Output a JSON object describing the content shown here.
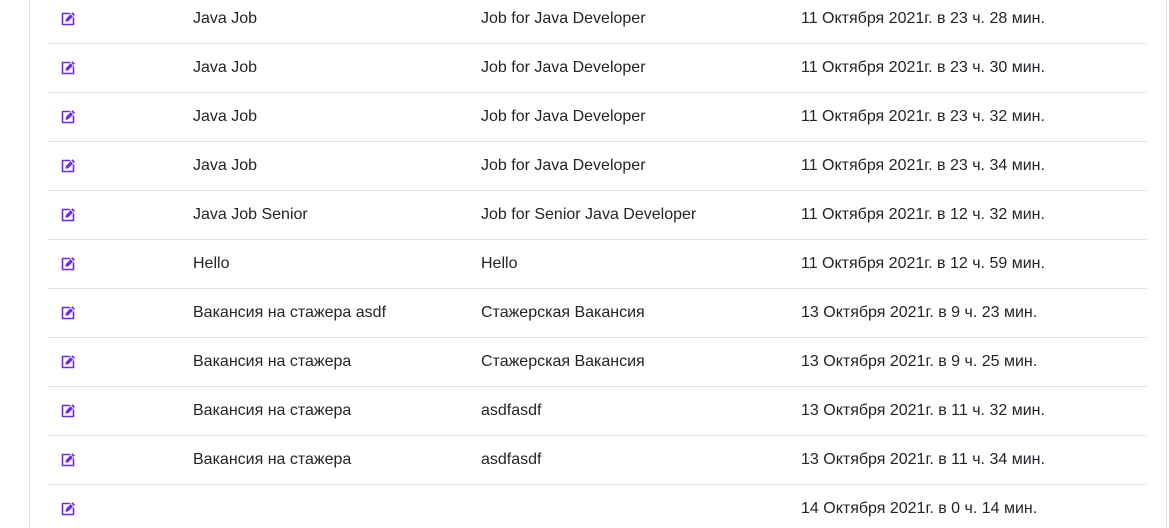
{
  "theme": {
    "icon_color": "#6b2bf0",
    "border_color": "#dee2e6",
    "text_color": "#212529"
  },
  "table": {
    "rows": [
      {
        "icon": "edit-icon",
        "name": "Java Job",
        "description": "Job for Java Developer",
        "created": "11 Октября 2021г. в 23 ч. 28 мин."
      },
      {
        "icon": "edit-icon",
        "name": "Java Job",
        "description": "Job for Java Developer",
        "created": "11 Октября 2021г. в 23 ч. 30 мин."
      },
      {
        "icon": "edit-icon",
        "name": "Java Job",
        "description": "Job for Java Developer",
        "created": "11 Октября 2021г. в 23 ч. 32 мин."
      },
      {
        "icon": "edit-icon",
        "name": "Java Job",
        "description": "Job for Java Developer",
        "created": "11 Октября 2021г. в 23 ч. 34 мин."
      },
      {
        "icon": "edit-icon",
        "name": "Java Job Senior",
        "description": "Job for Senior Java Developer",
        "created": "11 Октября 2021г. в 12 ч. 32 мин."
      },
      {
        "icon": "edit-icon",
        "name": "Hello",
        "description": "Hello",
        "created": "11 Октября 2021г. в 12 ч. 59 мин."
      },
      {
        "icon": "edit-icon",
        "name": "Вакансия на стажера asdf",
        "description": "Стажерская Вакансия",
        "created": "13 Октября 2021г. в 9 ч. 23 мин."
      },
      {
        "icon": "edit-icon",
        "name": "Вакансия на стажера",
        "description": "Стажерская Вакансия",
        "created": "13 Октября 2021г. в 9 ч. 25 мин."
      },
      {
        "icon": "edit-icon",
        "name": "Вакансия на стажера",
        "description": "asdfasdf",
        "created": "13 Октября 2021г. в 11 ч. 32 мин."
      },
      {
        "icon": "edit-icon",
        "name": "Вакансия на стажера",
        "description": "asdfasdf",
        "created": "13 Октября 2021г. в 11 ч. 34 мин."
      },
      {
        "icon": "edit-icon",
        "name": "",
        "description": "",
        "created": "14 Октября 2021г. в 0 ч. 14 мин."
      }
    ]
  }
}
